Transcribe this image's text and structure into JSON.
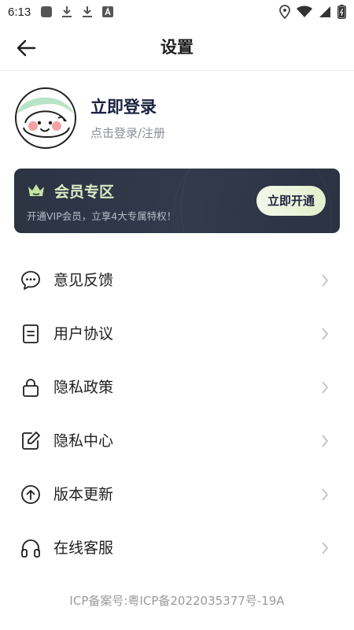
{
  "status_bar": {
    "time": "6:13",
    "left_icons": [
      "app-icon",
      "download-icon",
      "download-icon",
      "font-icon"
    ],
    "right_icons": [
      "location-icon",
      "wifi-icon",
      "signal-icon",
      "battery-icon"
    ]
  },
  "header": {
    "title": "设置",
    "back_icon": "arrow-left-icon"
  },
  "profile": {
    "title": "立即登录",
    "subtitle": "点击登录/注册",
    "avatar_bg": "#b9e3c6"
  },
  "vip": {
    "title": "会员专区",
    "description": "开通VIP会员，立享4大专属特权！",
    "button": "立即开通",
    "title_color": "#d9ecc4"
  },
  "menu": [
    {
      "label": "意见反馈",
      "icon": "chat-bubble-icon"
    },
    {
      "label": "用户协议",
      "icon": "document-icon"
    },
    {
      "label": "隐私政策",
      "icon": "lock-icon"
    },
    {
      "label": "隐私中心",
      "icon": "edit-note-icon"
    },
    {
      "label": "版本更新",
      "icon": "upgrade-icon"
    },
    {
      "label": "在线客服",
      "icon": "headset-icon"
    }
  ],
  "footer": {
    "icp": "ICP备案号:粤ICP备2022035377号-19A"
  }
}
